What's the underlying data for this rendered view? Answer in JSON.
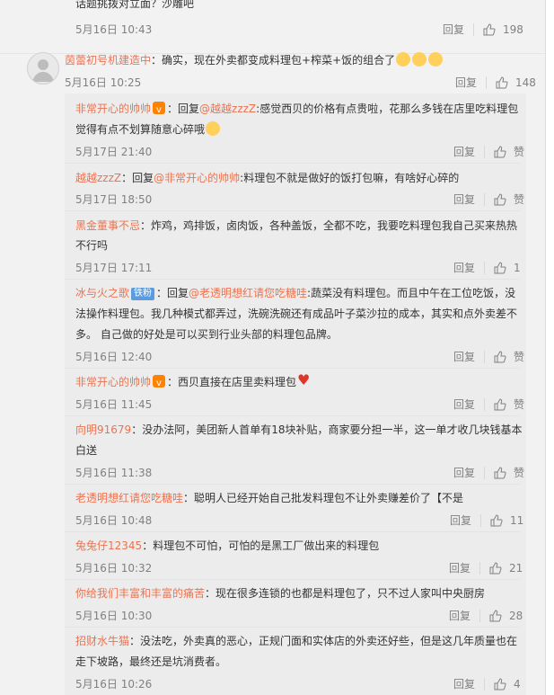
{
  "top_comment": {
    "text": "话题挑拨对立面？沙雕吧",
    "time": "5月16日 10:43",
    "reply": "回复",
    "likes": "198"
  },
  "main_comment": {
    "user": "茵蕾初号机建造中",
    "text": "：确实，现在外卖都变成料理包+榨菜+饭的组合了",
    "time": "5月16日 10:25",
    "reply": "回复",
    "likes": "148"
  },
  "replies": [
    {
      "user": "非常开心的帅帅",
      "pre": "：回复",
      "mention": "@越越zzzZ",
      "line1": ":感觉西贝的价格有点贵啦，花那么多钱在店里吃料理包",
      "line2": "觉得有点不划算随意心碎哦",
      "time": "5月17日 21:40",
      "reply": "回复",
      "like_label": "赞"
    },
    {
      "user": "越越zzzZ",
      "pre": "：回复",
      "mention": "@非常开心的帅帅",
      "line1": ":料理包不就是做好的饭打包嘛，有啥好心碎的",
      "time": "5月17日 18:50",
      "reply": "回复",
      "like_label": "赞"
    },
    {
      "user": "黑金董事不忌",
      "line1": "：炸鸡，鸡排饭，卤肉饭，各种盖饭，全都不吃，我要吃料理包我自己买来热热",
      "line2": "不行吗",
      "time": "5月17日 17:11",
      "reply": "回复",
      "likes": "1"
    },
    {
      "user": "冰与火之歌",
      "fan_badge": "铁粉",
      "pre": "：回复",
      "mention": "@老透明想红请您吃糖哇",
      "line1": ":蔬菜没有料理包。而且中午在工位吃饭，没",
      "line2": "法操作料理包。我几种模式都弄过，洗碗洗碗还有成品叶子菜沙拉的成本，其实和点外卖差不",
      "line3": "多。 自己做的好处是可以买到行业头部的料理包品牌。",
      "time": "5月16日 12:40",
      "reply": "回复",
      "like_label": "赞"
    },
    {
      "user": "非常开心的帅帅",
      "line1": "：西贝直接在店里卖料理包",
      "time": "5月16日 11:45",
      "reply": "回复",
      "like_label": "赞"
    },
    {
      "user": "向明91679",
      "line1": "：没办法阿，美团新人首单有18块补贴，商家要分担一半，这一单才收几块钱基本",
      "line2": "白送",
      "time": "5月16日 11:38",
      "reply": "回复",
      "like_label": "赞"
    },
    {
      "user": "老透明想红请您吃糖哇",
      "line1": "：聪明人已经开始自己批发料理包不让外卖赚差价了【不是",
      "time": "5月16日 10:48",
      "reply": "回复",
      "likes": "11"
    },
    {
      "user": "兔兔仔12345",
      "line1": "：料理包不可怕，可怕的是黑工厂做出来的料理包",
      "time": "5月16日 10:32",
      "reply": "回复",
      "likes": "21"
    },
    {
      "user": "你给我们丰富和丰富的痛苦",
      "line1": "：现在很多连锁的也都是料理包了，只不过人家叫中央厨房",
      "time": "5月16日 10:30",
      "reply": "回复",
      "likes": "28"
    },
    {
      "user": "招财水牛猫",
      "line1": "：没法吃，外卖真的恶心，正规门面和实体店的外卖还好些，但是这几年质量也在",
      "line2": "走下坡路，最终还是坑消费者。",
      "time": "5月16日 10:26",
      "reply": "回复",
      "likes": "4"
    }
  ],
  "colors": {
    "username": "#eb7350",
    "meta": "#808080",
    "background": "#f2f2f2"
  },
  "icons": [
    "thumbs-up-icon",
    "vip-badge-icon",
    "laugh-emoji-icon",
    "broken-heart-emoji-icon",
    "avatar-icon"
  ]
}
